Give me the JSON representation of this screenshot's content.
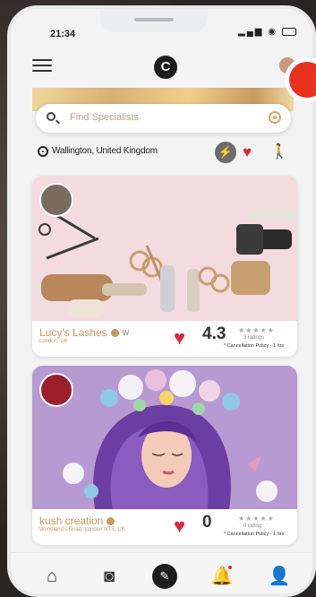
{
  "status": {
    "time": "21:34"
  },
  "header": {
    "logo_text": "C"
  },
  "search": {
    "placeholder": "Find Specialists"
  },
  "location": {
    "text": "Wallington, United Kingdom"
  },
  "cards": [
    {
      "title": "Lucy's Lashes",
      "subtitle": "London, UK",
      "tag": "W",
      "rating": "4.3",
      "stars": "★★★★★",
      "ratings_count": "3 ratings",
      "policy": "* Cancellation Policy - 1 hrs"
    },
    {
      "title": "kush creation",
      "subtitle": "Woodland's Road, London NTS, UK",
      "rating": "0",
      "stars": "★★★★★",
      "ratings_count": "0 rating",
      "policy": "* Cancellation Policy - 1 hrs"
    }
  ],
  "colors": {
    "accent": "#c9985c",
    "heart": "#e0263a",
    "nav_center": "#1d1d1d"
  },
  "icons": [
    "menu-icon",
    "search-icon",
    "locate-icon",
    "location-pin-icon",
    "bolt-icon",
    "heart-icon",
    "walk-icon",
    "home-icon",
    "camera-icon",
    "brush-icon",
    "bell-icon",
    "user-icon"
  ]
}
